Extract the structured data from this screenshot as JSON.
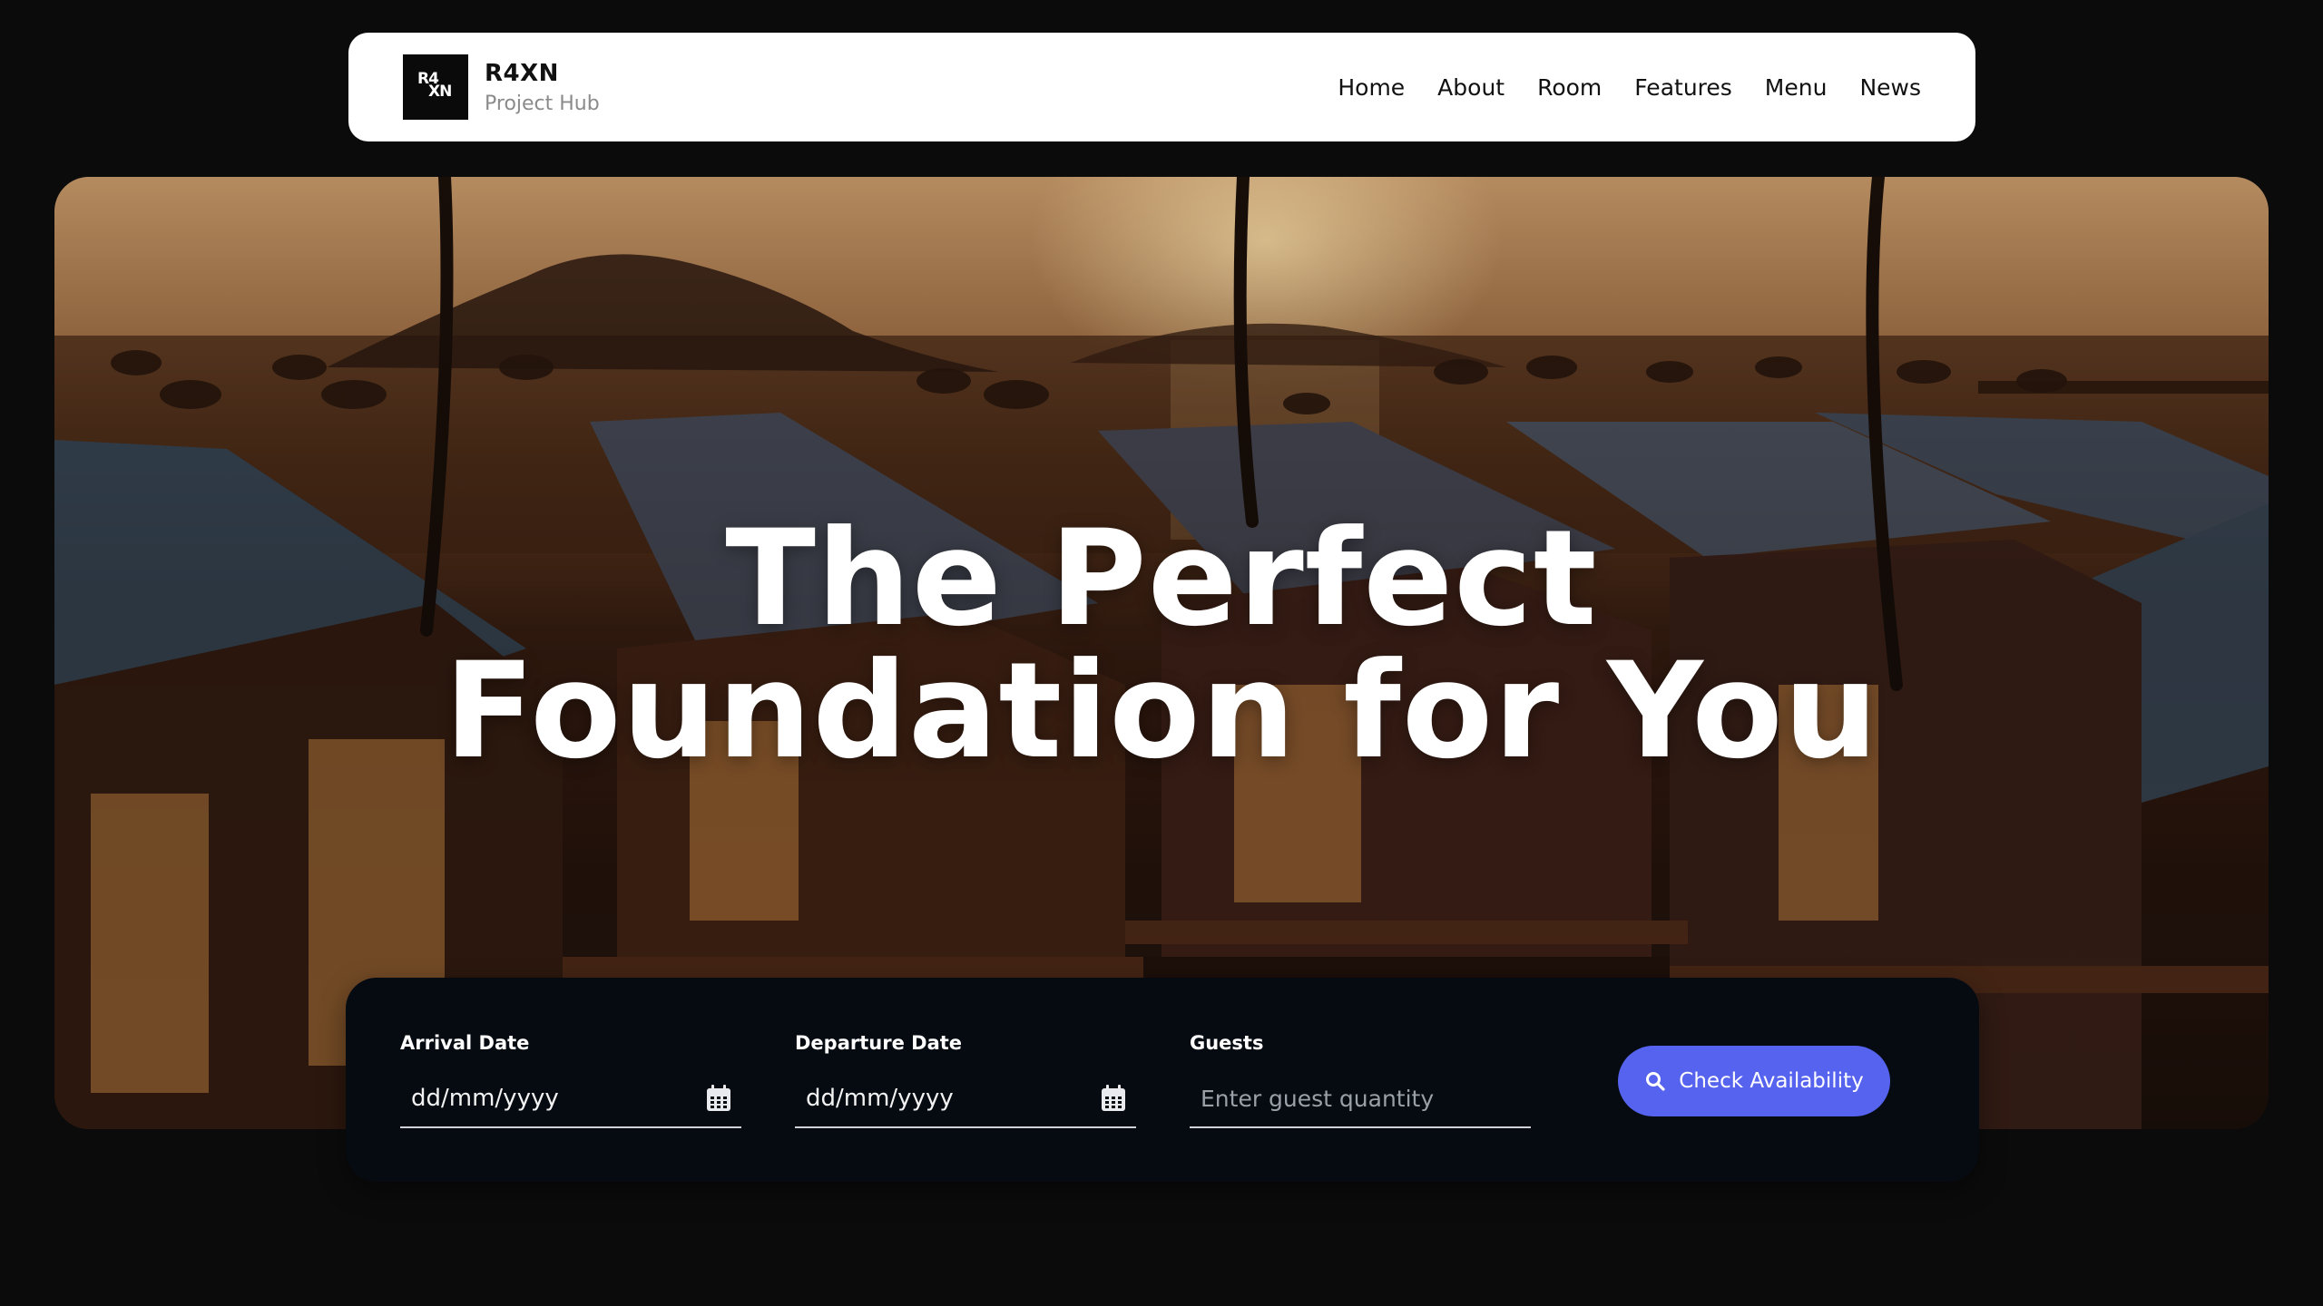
{
  "brand": {
    "logo_text_top": "R4",
    "logo_text_bottom": "XN",
    "name": "R4XN",
    "subtitle": "Project Hub"
  },
  "nav": {
    "items": [
      {
        "label": "Home"
      },
      {
        "label": "About"
      },
      {
        "label": "Room"
      },
      {
        "label": "Features"
      },
      {
        "label": "Menu"
      },
      {
        "label": "News"
      }
    ]
  },
  "hero": {
    "headline_line1": "The Perfect",
    "headline_line2": "Foundation for You",
    "image_subject": "tropical-resort-bungalows-at-sunset"
  },
  "booking": {
    "arrival": {
      "label": "Arrival Date",
      "value": "dd/mm/yyyy",
      "icon": "calendar-icon"
    },
    "departure": {
      "label": "Departure Date",
      "value": "dd/mm/yyyy",
      "icon": "calendar-icon"
    },
    "guests": {
      "label": "Guests",
      "placeholder": "Enter guest quantity"
    },
    "submit": {
      "label": "Check Availability",
      "icon": "search-icon"
    }
  },
  "colors": {
    "page_background": "#0b0b0c",
    "navbar_background": "#ffffff",
    "booking_background": "#060b12",
    "accent": "#5663ee",
    "text_light": "#ffffff"
  }
}
